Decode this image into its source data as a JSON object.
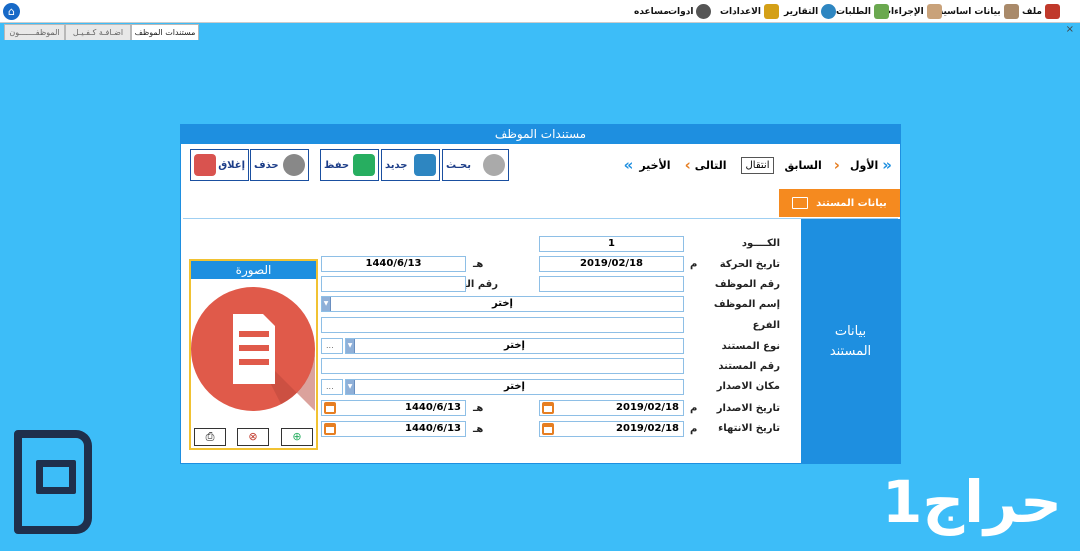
{
  "menu": {
    "file": "ملف",
    "basic_data": "بيانات اساسية",
    "procedures": "الإجراءات",
    "requests": "الطلبات",
    "reports": "التقارير",
    "settings": "الاعدادات",
    "tools": "ادوات",
    "help": "مساعده"
  },
  "close_char": "×",
  "tabs": {
    "employee_documents": "مستندات الموظف",
    "add_sponsorship": "اضـافـة كـفـيـل",
    "employees": "الموظفـــــــون"
  },
  "window": {
    "title": "مستندات الموظف",
    "nav": {
      "first": "الأول",
      "previous": "السابق",
      "goto": "انتقال",
      "next": "التالى",
      "last": "الأخير"
    },
    "toolbar": {
      "search": "بحـث",
      "new": "جديد",
      "save": "حفظ",
      "delete": "حذف",
      "close": "إغلاق"
    },
    "data_tab": "بيانات المستند",
    "side_label": "بيانات\nالمستند"
  },
  "form": {
    "code_label": "الكــــود",
    "code_value": "1",
    "movement_date_label": "تاريخ الحركة",
    "movement_date_greg": "2019/02/18",
    "movement_date_hijri": "1440/6/13",
    "greg_suffix": "م",
    "hijri_suffix": "هـ",
    "employee_no_label": "رقم الموظف",
    "employee_no_value": "",
    "id_no_label": "رقم الهوية",
    "id_no_value": "",
    "employee_name_label": "إسم الموظف",
    "employee_name_value": "إختر",
    "branch_label": "الفرع",
    "branch_value": "",
    "doc_type_label": "نوع المستند",
    "doc_type_value": "إختر",
    "doc_no_label": "رقم المستند",
    "doc_no_value": "",
    "issue_place_label": "مكان الاصدار",
    "issue_place_value": "إختر",
    "ellipsis": "...",
    "issue_date_label": "تاريخ الاصدار",
    "issue_date_greg": "2019/02/18",
    "issue_date_hijri": "1440/6/13",
    "expiry_date_label": "تاريخ الانتهاء",
    "expiry_date_greg": "2019/02/18",
    "expiry_date_hijri": "1440/6/13"
  },
  "photo": {
    "title": "الصورة"
  },
  "watermark": "حراج1",
  "colors": {
    "background": "#3dbdf8",
    "accent_blue": "#1e8fe0",
    "orange": "#f58a1f",
    "document_red": "#e05a4a"
  }
}
